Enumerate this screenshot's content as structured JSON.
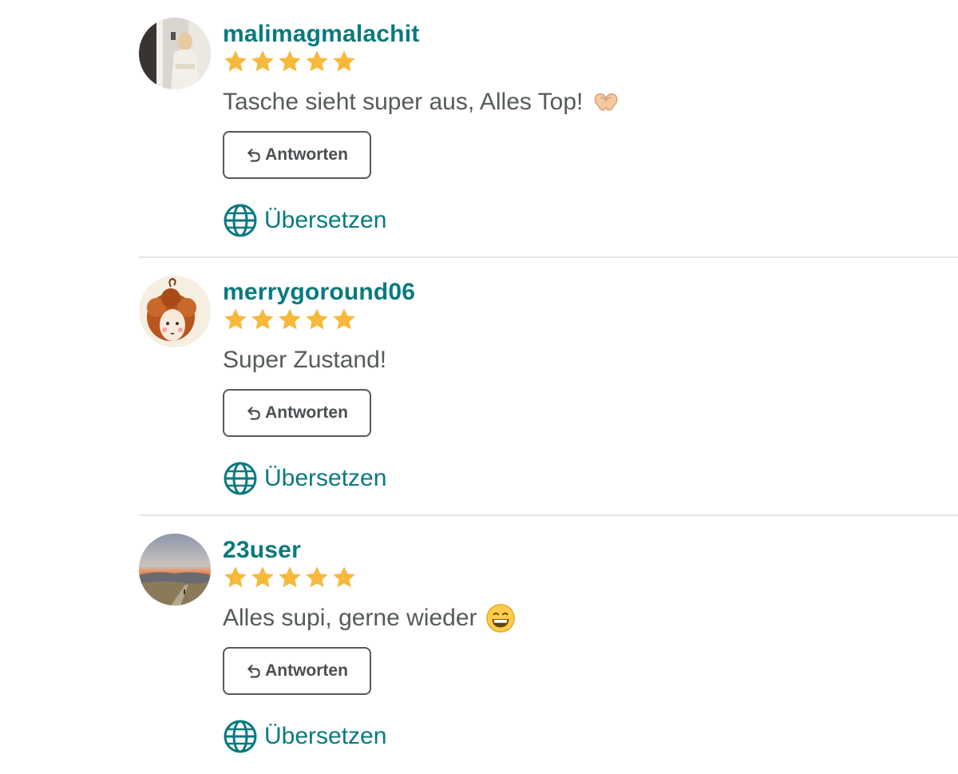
{
  "reviews": [
    {
      "username": "malimagmalachit",
      "rating": 5,
      "comment": "Tasche sieht super aus, Alles Top!",
      "comment_emoji": "heart-hands-emoji",
      "reply_label": "Antworten",
      "translate_label": "Übersetzen"
    },
    {
      "username": "merrygoround06",
      "rating": 5,
      "comment": "Super Zustand!",
      "reply_label": "Antworten",
      "translate_label": "Übersetzen"
    },
    {
      "username": "23user",
      "rating": 5,
      "comment": "Alles supi, gerne wieder",
      "comment_emoji": "grinning-face-emoji",
      "reply_label": "Antworten",
      "translate_label": "Übersetzen"
    }
  ],
  "colors": {
    "accent": "#087a7e",
    "star": "#f6b93b",
    "text": "#555a5c",
    "divider": "#e6e6e6"
  }
}
